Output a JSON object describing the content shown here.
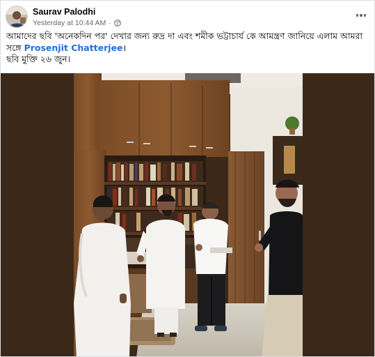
{
  "post": {
    "author": "Saurav Palodhi",
    "timestamp": "Yesterday at 10:44 AM",
    "separator": "·",
    "privacy_icon": "globe-icon",
    "more_icon": "more-options-icon",
    "text_line1": "আমাদের ছবি 'অনেকদিন পর' দেখার জন্য রুদ্র দা এবং শমীক ভট্টাচার্য কে আমন্ত্রণ জানিয়ে এলাম আমরা",
    "text_line2_prefix": "সঙ্গে",
    "mention": "Prosenjit Chatterjee",
    "text_line2_suffix": "।",
    "text_line3": "ছবি মুক্তি ২৬ জুন।"
  },
  "colors": {
    "mention": "#216fdb",
    "author": "#050505",
    "meta": "#65676b",
    "media_background": "#3b2819"
  }
}
